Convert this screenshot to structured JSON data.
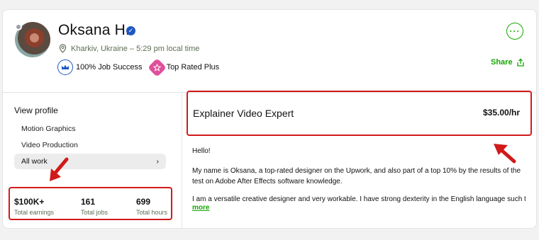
{
  "profile": {
    "name": "Oksana H.",
    "location": "Kharkiv, Ukraine – 5:29 pm local time",
    "badges": [
      {
        "label": "100% Job Success",
        "icon": "crown-icon"
      },
      {
        "label": "Top Rated Plus",
        "icon": "star-badge-icon"
      }
    ],
    "share_label": "Share",
    "more_icon": "ellipsis-icon"
  },
  "sidebar": {
    "heading": "View profile",
    "items": [
      "Motion Graphics",
      "Video Production"
    ],
    "active_item": "All work"
  },
  "stats": [
    {
      "value": "$100K+",
      "label": "Total earnings"
    },
    {
      "value": "161",
      "label": "Total jobs"
    },
    {
      "value": "699",
      "label": "Total hours"
    }
  ],
  "main": {
    "title": "Explainer Video Expert",
    "rate": "$35.00/hr",
    "description": [
      "Hello!",
      "My name is Oksana, a top-rated designer on the Upwork, and also part of a top 10% by the results of the test on Adobe After Effects software knowledge.",
      "I am a versatile creative designer and very workable. I have strong dexterity in the English language such that…"
    ],
    "more_label": "more"
  },
  "colors": {
    "accent_green": "#14a800",
    "highlight_red": "#d11a1a",
    "verified_blue": "#1f57c3",
    "top_rated_pink": "#e04f9b"
  }
}
